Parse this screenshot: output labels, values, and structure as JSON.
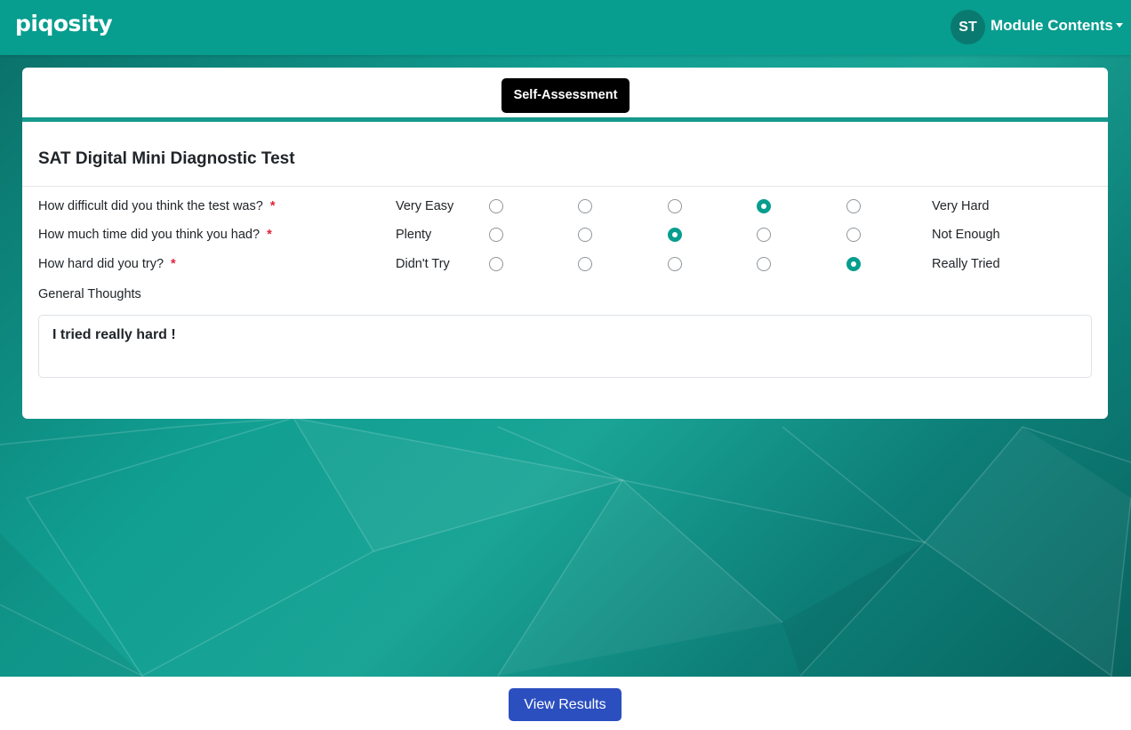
{
  "navbar": {
    "logo": "piqosity",
    "avatar_initials": "ST",
    "menu_label": "Module Contents",
    "menu_icon": "caret-down-icon"
  },
  "tab": {
    "label": "Self-Assessment"
  },
  "title": "SAT Digital Mini Diagnostic Test",
  "required_marker": "*",
  "questions": [
    {
      "label": "How difficult did you think the test was?",
      "min_label": "Very Easy",
      "max_label": "Very Hard",
      "selected": 4
    },
    {
      "label": "How much time did you think you had?",
      "min_label": "Plenty",
      "max_label": "Not Enough",
      "selected": 3
    },
    {
      "label": "How hard did you try?",
      "min_label": "Didn't Try",
      "max_label": "Really Tried",
      "selected": 5
    }
  ],
  "general_thoughts": {
    "label": "General Thoughts",
    "value": "I tried really hard !"
  },
  "footer": {
    "button_label": "View Results"
  },
  "colors": {
    "brand_teal": "#079d8f",
    "primary_blue": "#2c4fbf",
    "required_red": "#e0243b"
  }
}
